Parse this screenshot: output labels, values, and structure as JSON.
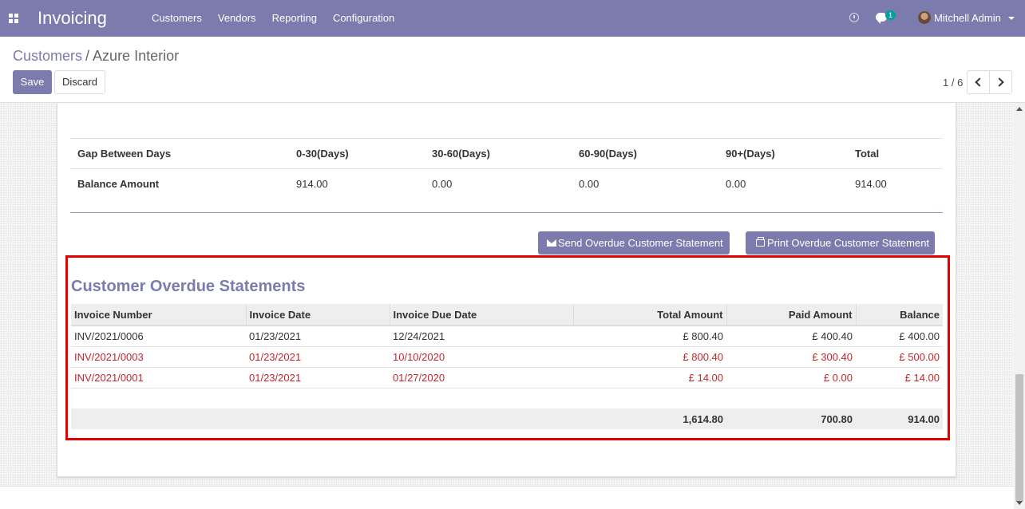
{
  "navbar": {
    "app_title": "Invoicing",
    "menu": [
      "Customers",
      "Vendors",
      "Reporting",
      "Configuration"
    ],
    "chat_badge": "1",
    "user_name": "Mitchell Admin",
    "bg_color": "#7c7bad"
  },
  "control_panel": {
    "breadcrumb_parent": "Customers",
    "breadcrumb_separator": "/",
    "breadcrumb_current": "Azure Interior",
    "save_label": "Save",
    "discard_label": "Discard",
    "pager_value": "1 / 6"
  },
  "aging": {
    "header": [
      "Gap Between Days",
      "0-30(Days)",
      "30-60(Days)",
      "60-90(Days)",
      "90+(Days)",
      "Total"
    ],
    "row": [
      "Balance Amount",
      "914.00",
      "0.00",
      "0.00",
      "0.00",
      "914.00"
    ]
  },
  "actions": {
    "send_label": "Send Overdue Customer Statement",
    "print_label": "Print Overdue Customer Statement"
  },
  "overdue": {
    "title": "Customer Overdue Statements",
    "columns": [
      "Invoice Number",
      "Invoice Date",
      "Invoice Due Date",
      "Total Amount",
      "Paid Amount",
      "Balance"
    ],
    "rows": [
      [
        "INV/2021/0006",
        "01/23/2021",
        "12/24/2021",
        "£ 800.40",
        "£ 400.40",
        "£ 400.00"
      ],
      [
        "INV/2021/0003",
        "01/23/2021",
        "10/10/2020",
        "£ 800.40",
        "£ 300.40",
        "£ 500.00"
      ],
      [
        "INV/2021/0001",
        "01/23/2021",
        "01/27/2020",
        "£ 14.00",
        "£ 0.00",
        "£ 14.00"
      ]
    ],
    "totals": [
      "1,614.80",
      "700.80",
      "914.00"
    ],
    "overdue_color": "#c0282d",
    "highlight_color": "#e00000"
  }
}
